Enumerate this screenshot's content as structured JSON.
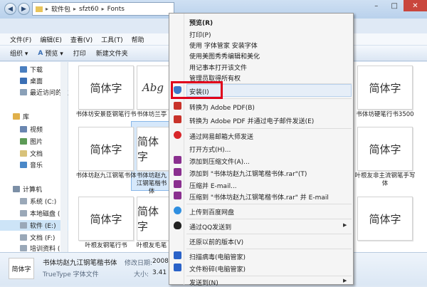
{
  "address": {
    "crumbs": [
      "软件包",
      "sfzt60",
      "Fonts"
    ]
  },
  "menubar": [
    "文件(F)",
    "编辑(E)",
    "查看(V)",
    "工具(T)",
    "帮助"
  ],
  "toolbar": {
    "organize": "组织 ▾",
    "preview": "预览 ▾",
    "print": "打印",
    "new_folder": "新建文件夹"
  },
  "sidebar": {
    "items": [
      {
        "label": "下载",
        "color": "#4a7fc0"
      },
      {
        "label": "桌面",
        "color": "#3a6fb5"
      },
      {
        "label": "最近访问的位置",
        "color": "#8aa0b8"
      },
      {
        "label": "库",
        "color": "#e0b04a"
      },
      {
        "label": "视频",
        "color": "#6a86b0"
      },
      {
        "label": "图片",
        "color": "#5c9a56"
      },
      {
        "label": "文档",
        "color": "#d8c27a"
      },
      {
        "label": "音乐",
        "color": "#4a88c8"
      },
      {
        "label": "计算机",
        "color": "#7c8fa6"
      },
      {
        "label": "系统 (C:)",
        "color": "#9aa8b8"
      },
      {
        "label": "本地磁盘 (",
        "color": "#9aa8b8"
      },
      {
        "label": "软件 (E:)",
        "color": "#9aa8b8"
      },
      {
        "label": "文档 (F:)",
        "color": "#9aa8b8"
      },
      {
        "label": "培训资料 (",
        "color": "#9aa8b8"
      }
    ]
  },
  "files": {
    "tiles": [
      {
        "glyph": "简体字",
        "name": "书体坊安景臣钢笔行书"
      },
      {
        "glyph": "Abg",
        "name": "书体坊兰亭"
      },
      {
        "glyph": "简体字",
        "name": "书体坊硬笔行书3500"
      },
      {
        "glyph": "简体字",
        "name": "书体坊赵九江钢笔书体"
      },
      {
        "glyph": "简体字",
        "name": "书体坊赵九江钢笔楷书体"
      },
      {
        "glyph": "简体字",
        "name": "叶根友非主流钢笔手写体"
      },
      {
        "glyph": "简体字",
        "name": "叶根友钢笔行书"
      },
      {
        "glyph": "简体字",
        "name": "叶根友毛笔"
      },
      {
        "glyph": "简体字",
        "name": ""
      }
    ]
  },
  "details": {
    "thumb": "简体字",
    "name": "书体坊赵九江钢笔楷书体",
    "modified_label": "修改日期:",
    "modified_value": "2008-",
    "type": "TrueType 字体文件",
    "size_label": "大小:",
    "size_value": "3.41 M"
  },
  "context_menu": {
    "items": [
      {
        "label": "预览(R)",
        "bold": true
      },
      {
        "label": "打印(P)"
      },
      {
        "label": "使用 字体管家 安装字体"
      },
      {
        "label": "使用美图秀秀编辑和美化"
      },
      {
        "label": "用记事本打开该文件"
      },
      {
        "label": "管理员取得所有权"
      },
      {
        "label": "安装(I)",
        "icon": "shield",
        "icon_color": "#3b77c9"
      },
      {
        "label": "转换为 Adobe PDF(B)",
        "icon": "pdf",
        "icon_color": "#c8322a"
      },
      {
        "label": "转换为 Adobe PDF 并通过电子邮件发送(E)",
        "icon": "pdf",
        "icon_color": "#c8322a"
      },
      {
        "label": "通过网易邮箱大师发送",
        "icon": "mail",
        "icon_color": "#d8262a"
      },
      {
        "label": "打开方式(H)..."
      },
      {
        "label": "添加到压缩文件(A)...",
        "icon": "rar",
        "icon_color": "#8a2f8f"
      },
      {
        "label": "添加到 \"书体坊赵九江钢笔楷书体.rar\"(T)",
        "icon": "rar",
        "icon_color": "#8a2f8f"
      },
      {
        "label": "压缩并 E-mail...",
        "icon": "rar",
        "icon_color": "#8a2f8f"
      },
      {
        "label": "压缩到 \"书体坊赵九江钢笔楷书体.rar\" 并 E-mail",
        "icon": "rar",
        "icon_color": "#8a2f8f"
      },
      {
        "label": "上传到百度网盘",
        "icon": "cloud",
        "icon_color": "#2f8fe0"
      },
      {
        "label": "通过QQ发送到",
        "icon": "qq",
        "icon_color": "#222222"
      },
      {
        "label": "还原以前的版本(V)"
      },
      {
        "label": "扫描病毒(电脑管家)",
        "icon": "shield-blue",
        "icon_color": "#2a62c8"
      },
      {
        "label": "文件粉碎(电脑管家)",
        "icon": "shield-blue",
        "icon_color": "#2a62c8"
      },
      {
        "label": "发送到(N)"
      }
    ]
  }
}
